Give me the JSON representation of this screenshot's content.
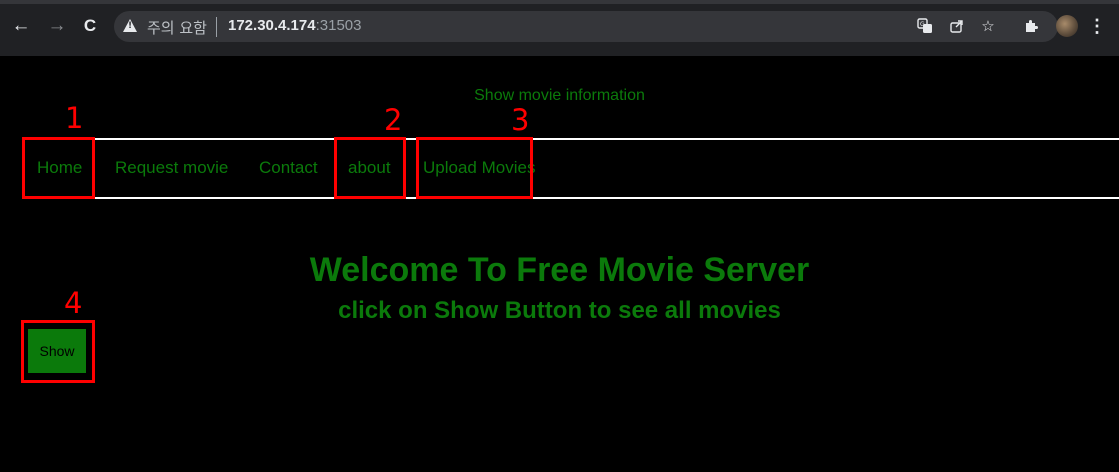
{
  "browser": {
    "back_icon": "←",
    "forward_icon": "→",
    "reload_icon": "C",
    "security_warning": "주의 요함",
    "url_host": "172.30.4.174",
    "url_port": ":31503",
    "translate_icon": "translate-icon",
    "share_icon": "share-icon",
    "bookmark_icon": "☆",
    "extensions_icon": "puzzle-icon",
    "menu_icon": "⋮"
  },
  "page": {
    "header": "Show movie information",
    "nav": [
      {
        "label": "Home"
      },
      {
        "label": "Request movie"
      },
      {
        "label": "Contact"
      },
      {
        "label": "about"
      },
      {
        "label": "Upload Movies"
      }
    ],
    "welcome_title": "Welcome To Free Movie Server",
    "welcome_subtitle": "click on Show Button to see all movies",
    "show_button": "Show",
    "text_color": "#0b7a0b",
    "background": "#000000"
  },
  "annotations": [
    {
      "number": "1"
    },
    {
      "number": "2"
    },
    {
      "number": "3"
    },
    {
      "number": "4"
    }
  ],
  "colors": {
    "annotation": "#ff0000",
    "chrome_bar": "#202124",
    "omnibox": "#35363a"
  }
}
